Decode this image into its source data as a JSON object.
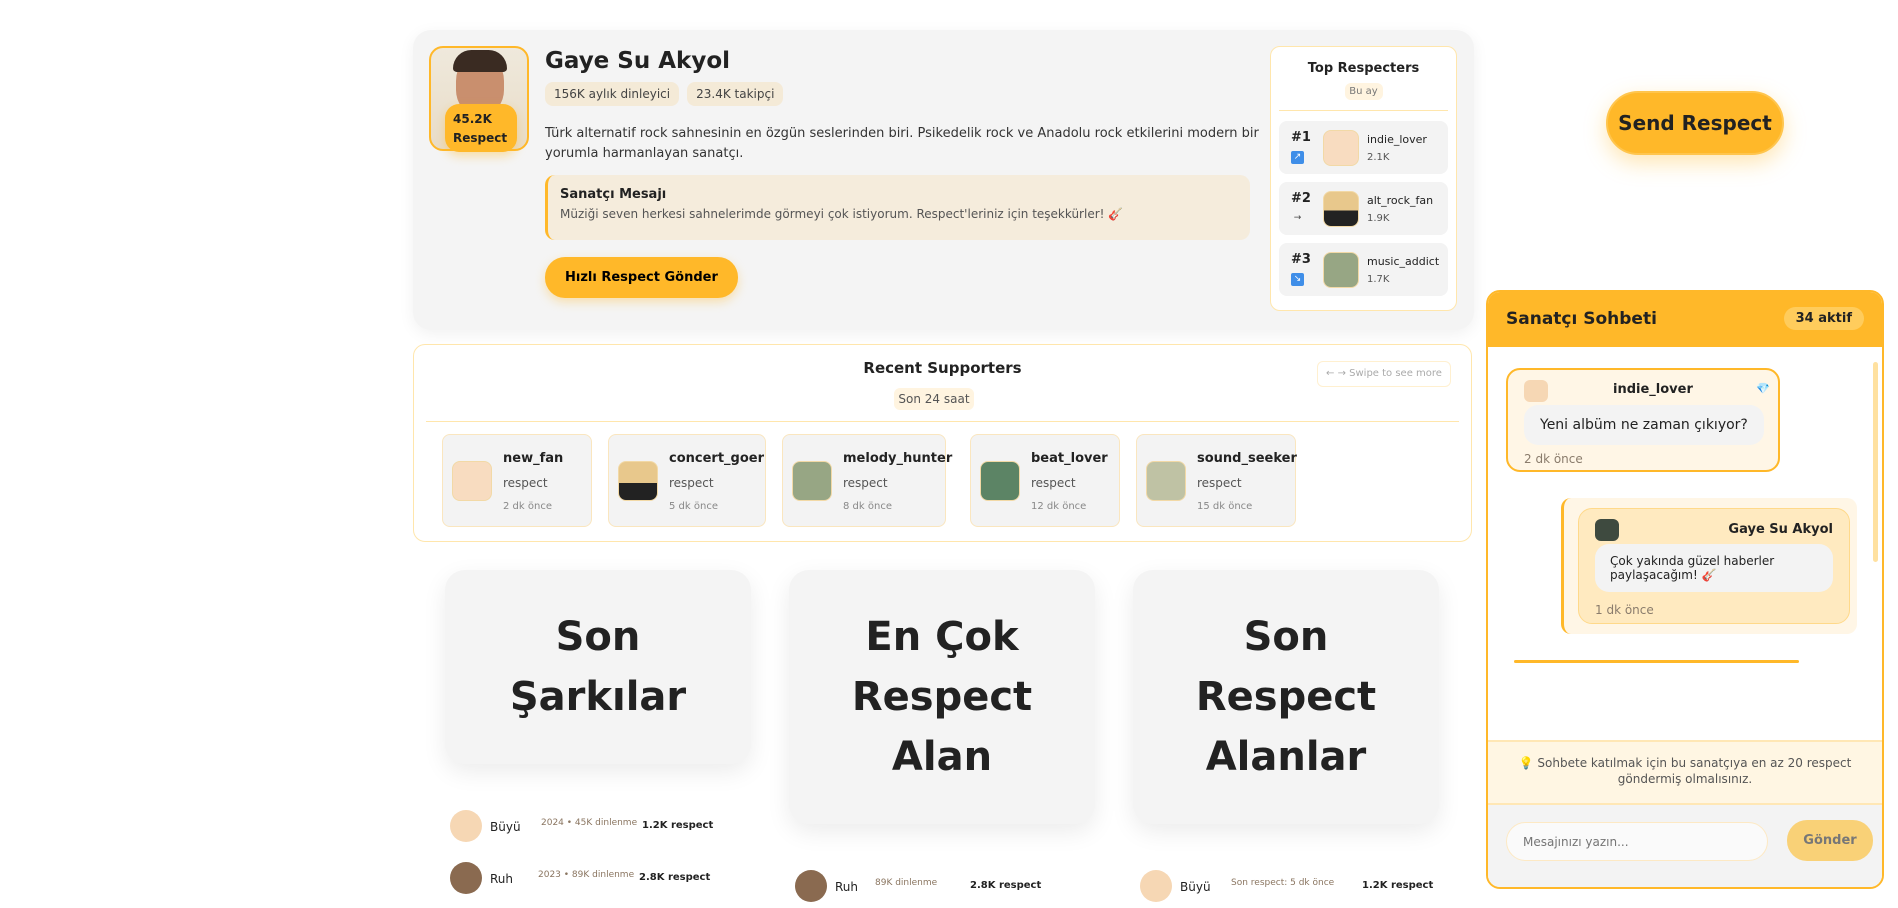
{
  "artist": {
    "name": "Gaye Su Akyol",
    "respect_count": "45.2K",
    "respect_label": "Respect",
    "listeners": "156K aylık dinleyici",
    "followers": "23.4K takipçi",
    "description": "Türk alternatif rock sahnesinin en özgün seslerinden biri. Psikedelik rock ve Anadolu rock etkilerini modern bir yorumla harmanlayan sanatçı.",
    "message_title": "Sanatçı Mesajı",
    "message": "Müziği seven herkesi sahnelerimde görmeyi çok istiyorum. Respect'leriniz için teşekkürler! 🎸",
    "quick_button": "Hızlı Respect Gönder"
  },
  "top_respecters": {
    "title": "Top Respecters",
    "period": "Bu ay",
    "items": [
      {
        "rank": "#1",
        "trend": "↗",
        "name": "indie_lover",
        "value": "2.1K"
      },
      {
        "rank": "#2",
        "trend": "→",
        "name": "alt_rock_fan",
        "value": "1.9K"
      },
      {
        "rank": "#3",
        "trend": "↘",
        "name": "music_addict",
        "value": "1.7K"
      }
    ]
  },
  "send_respect": "Send Respect",
  "supporters": {
    "title": "Recent Supporters",
    "period": "Son 24 saat",
    "swipe_hint": "← → Swipe to see more",
    "items": [
      {
        "name": "new_fan",
        "type": "respect",
        "time": "2 dk önce"
      },
      {
        "name": "concert_goer",
        "type": "respect",
        "time": "5 dk önce"
      },
      {
        "name": "melody_hunter",
        "type": "respect",
        "time": "8 dk önce"
      },
      {
        "name": "beat_lover",
        "type": "respect",
        "time": "12 dk önce"
      },
      {
        "name": "sound_seeker",
        "type": "respect",
        "time": "15 dk önce"
      }
    ]
  },
  "sections": [
    {
      "title": "Son Şarkılar",
      "songs": [
        {
          "title": "Büyü",
          "meta": "2024 • 45K dinlenme",
          "respect": "1.2K respect"
        },
        {
          "title": "Ruh",
          "meta": "2023 • 89K dinlenme",
          "respect": "2.8K respect"
        }
      ]
    },
    {
      "title": "En Çok Respect Alan",
      "songs": [
        {
          "title": "Ruh",
          "meta": "89K dinlenme",
          "respect": "2.8K respect"
        }
      ]
    },
    {
      "title": "Son Respect Alanlar",
      "songs": [
        {
          "title": "Büyü",
          "meta": "Son respect: 5 dk önce",
          "respect": "1.2K respect"
        }
      ]
    }
  ],
  "chat": {
    "title": "Sanatçı Sohbeti",
    "active": "34 aktif",
    "messages": [
      {
        "user": "indie_lover",
        "badge": "💎",
        "text": "Yeni albüm ne zaman çıkıyor?",
        "time": "2 dk önce"
      },
      {
        "user": "Gaye Su Akyol",
        "text": "Çok yakında güzel haberler paylaşacağım! 🎸",
        "time": "1 dk önce"
      }
    ],
    "notice": "💡 Sohbete katılmak için bu sanatçıya en az 20 respect göndermiş olmalısınız.",
    "placeholder": "Mesajınızı yazın...",
    "send": "Gönder"
  },
  "colors": {
    "accent": "#ffb829",
    "card_bg": "#f4f4f4",
    "highlight": "#fff6e6"
  }
}
